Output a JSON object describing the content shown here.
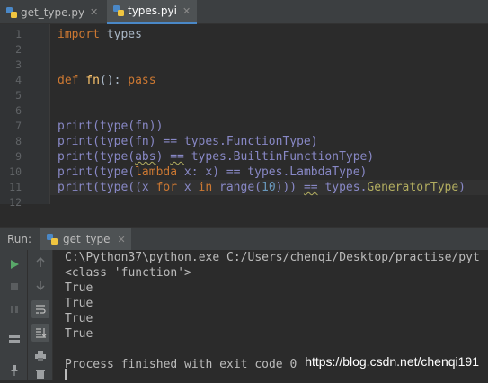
{
  "tabs": [
    {
      "label": "get_type.py",
      "close": "✕"
    },
    {
      "label": "types.pyi",
      "close": "✕"
    }
  ],
  "editor": {
    "line_numbers": [
      "1",
      "2",
      "3",
      "4",
      "5",
      "6",
      "7",
      "8",
      "9",
      "10",
      "11",
      "12"
    ],
    "lines": {
      "l1_kw": "import",
      "l1_rest": " types",
      "l4_kw": "def",
      "l4_fn": " fn",
      "l4_paren": "(): ",
      "l4_pass": "pass",
      "l7": "print(type(fn))",
      "l8": "print(type(fn) == types.FunctionType)",
      "l9a": "print(type(",
      "l9b": "abs",
      "l9c": ") ",
      "l9d": "==",
      "l9e": " types.BuiltinFunctionType)",
      "l10a": "print(type(",
      "l10b": "lambda",
      "l10c": " x: x) == types.LambdaType)",
      "l11a": "print(type((x ",
      "l11b": "for",
      "l11c": " x ",
      "l11d": "in",
      "l11e": " ",
      "l11f": "range",
      "l11g": "(",
      "l11h": "10",
      "l11i": "))) ",
      "l11j": "==",
      "l11k": " types.",
      "l11l": "GeneratorType",
      "l11m": ")"
    }
  },
  "run": {
    "label": "Run:",
    "tab_label": "get_type",
    "close": "✕"
  },
  "console": {
    "lines": [
      "C:\\Python37\\python.exe C:/Users/chenqi/Desktop/practise/pyt",
      "<class 'function'>",
      "True",
      "True",
      "True",
      "True",
      "",
      "Process finished with exit code 0"
    ]
  },
  "watermark": "https://blog.csdn.net/chenqi191",
  "colors": {
    "keyword": "#cc7832",
    "function": "#ffc66d",
    "number": "#6897bb",
    "builtin": "#8888c6",
    "run_green": "#59a869"
  }
}
